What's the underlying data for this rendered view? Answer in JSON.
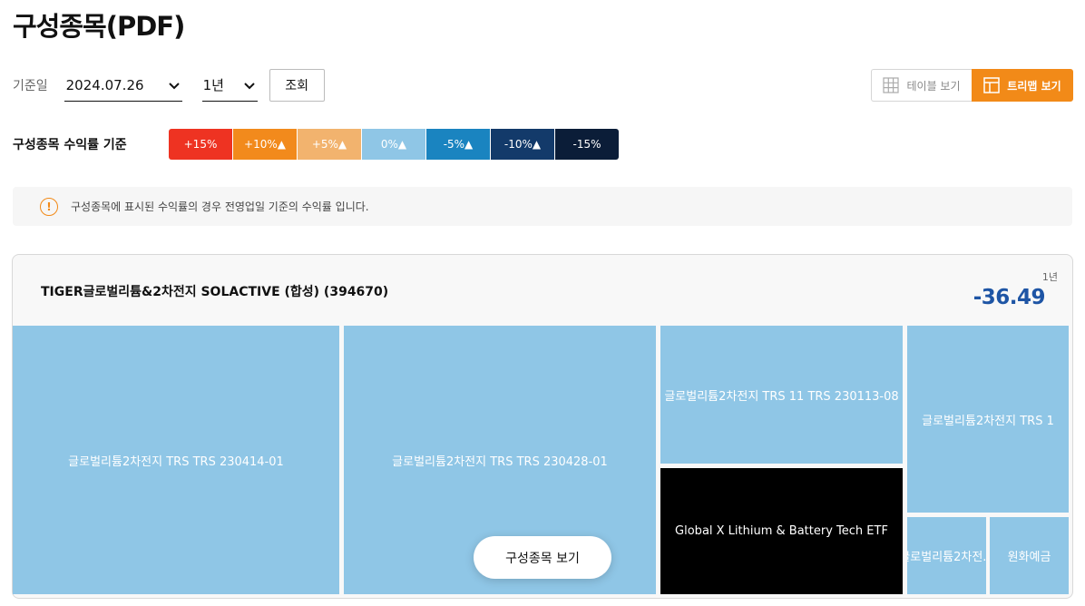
{
  "page_title": "구성종목(PDF)",
  "filters": {
    "date_label": "기준일",
    "date_value": "2024.07.26",
    "period_value": "1년",
    "search_button": "조회"
  },
  "view_toggle": {
    "table_label": "테이블 보기",
    "tree_label": "트리맵 보기",
    "active": "tree"
  },
  "legend": {
    "title": "구성종목 수익률 기준",
    "items": [
      {
        "label": "+15%",
        "color": "#ee3322"
      },
      {
        "label": "+10%▲",
        "color": "#f28a1c"
      },
      {
        "label": "+5%▲",
        "color": "#f2b36e"
      },
      {
        "label": "0%▲",
        "color": "#8fc6e6"
      },
      {
        "label": "-5%▲",
        "color": "#1a84c0"
      },
      {
        "label": "-10%▲",
        "color": "#133a6a"
      },
      {
        "label": "-15%",
        "color": "#0b1d38"
      }
    ]
  },
  "notice": {
    "icon": "!",
    "text": "구성종목에 표시된 수익률의 경우 전영업일 기준의 수익률 입니다."
  },
  "fund": {
    "name": "TIGER글로벌리튬&2차전지 SOLACTIVE (합성) (394670)",
    "period_label": "1년",
    "return_value": "-36.49"
  },
  "treemap": {
    "tiles": [
      {
        "label": "글로벌리튬2차전지 TRS TRS 230414-01",
        "color": "#8fc6e6"
      },
      {
        "label": "글로벌리튬2차전지 TRS TRS 230428-01",
        "color": "#8fc6e6"
      },
      {
        "label": "글로벌리튬2차전지 TRS 11 TRS 230113-08",
        "color": "#8fc6e6"
      },
      {
        "label": "글로벌리튬2차전지 TRS 1",
        "color": "#8fc6e6"
      },
      {
        "label": "Global X Lithium & Battery Tech ETF",
        "color": "#000000"
      },
      {
        "label": "글로벌리튬2차전...",
        "color": "#8fc6e6"
      },
      {
        "label": "원화예금",
        "color": "#8fc6e6"
      }
    ]
  },
  "view_holdings_button": "구성종목 보기"
}
